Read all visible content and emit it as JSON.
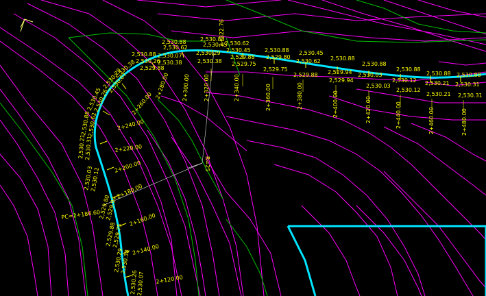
{
  "viewport": {
    "name": "drawing-model-space",
    "background": "#000000"
  },
  "colors": {
    "contour": "#ff00ff",
    "contour_index": "#00cc00",
    "alignment": "#00e5ff",
    "label": "#ffff00",
    "radius_line": "#bfbfbf",
    "edge_of_pavement": "#00e5ff"
  },
  "ucs_icon": "ucs-arrow-icon",
  "stations": [
    "2+120.00",
    "2+140.00",
    "2+160.00",
    "2+180.00",
    "2+200.00",
    "2+220.00",
    "2+240.00",
    "2+260.00",
    "2+280.00",
    "2+300.00",
    "2+320.00",
    "2+340.00",
    "2+360.00",
    "2+380.00",
    "2+400.00",
    "2+420.00",
    "2+440.00",
    "2+460.00",
    "2+480.00"
  ],
  "pc_label": "PC=2+186.60",
  "pt_label": "2+322.76",
  "radius_label": "R=25",
  "elevations": {
    "e1": "2,530.26",
    "e2": "2,530.07",
    "e3": "2,530.29",
    "e4": "2,530.38",
    "e5": "2,529.88",
    "e6": "2,529.75",
    "e7": "2,529.80",
    "e8": "2,529.94",
    "e9": "2,530.03",
    "e10": "2,530.12",
    "e11": "2,530.21",
    "e12": "2,530.31",
    "e13": "2,530.88",
    "e14": "2,530.62",
    "e15": "2,530.45"
  }
}
